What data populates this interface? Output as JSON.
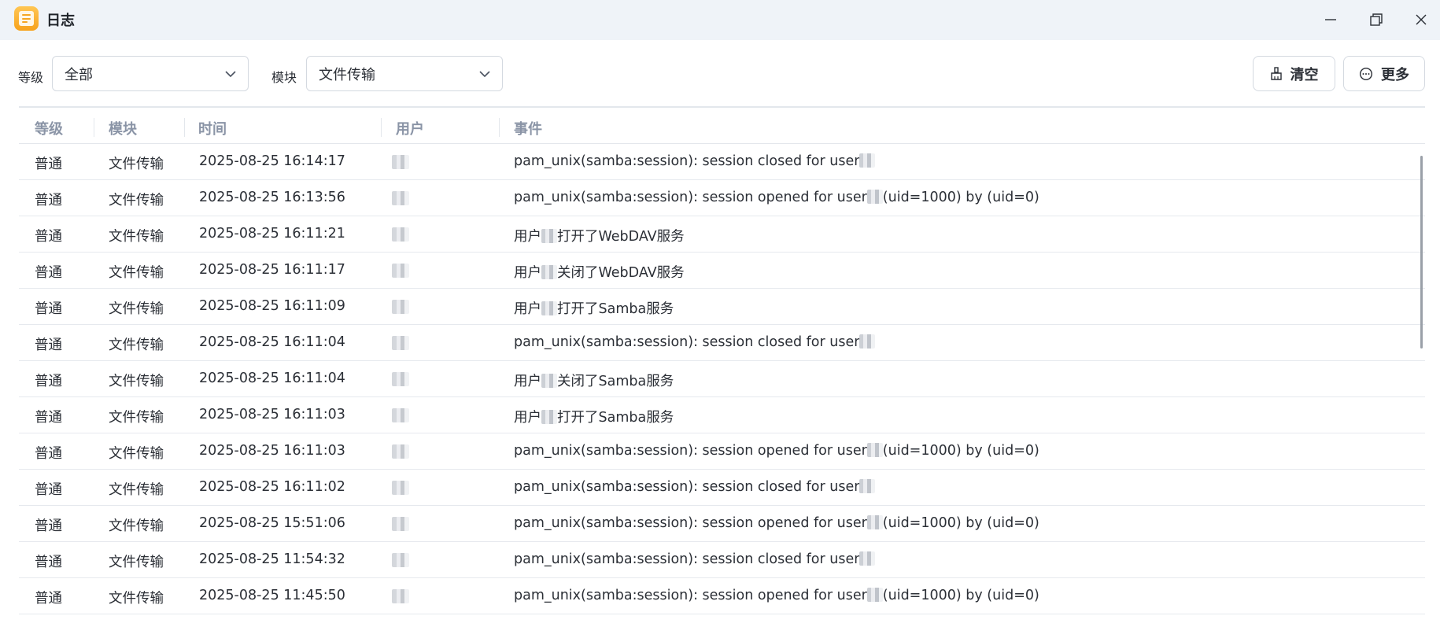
{
  "window": {
    "title": "日志",
    "controls": [
      "minimize-icon",
      "maximize-icon",
      "close-icon"
    ]
  },
  "filters": {
    "level_label": "等级",
    "level_value": "全部",
    "module_label": "模块",
    "module_value": "文件传输"
  },
  "actions": {
    "clear_label": "清空",
    "more_label": "更多"
  },
  "table": {
    "headers": [
      "等级",
      "模块",
      "时间",
      "用户",
      "事件"
    ],
    "rows": [
      {
        "level": "普通",
        "module": "文件传输",
        "time": "2025-08-25 16:14:17",
        "event_pre": "pam_unix(samba:session): session closed for user",
        "event_post": ""
      },
      {
        "level": "普通",
        "module": "文件传输",
        "time": "2025-08-25 16:13:56",
        "event_pre": "pam_unix(samba:session): session opened for user",
        "event_post": "(uid=1000) by (uid=0)"
      },
      {
        "level": "普通",
        "module": "文件传输",
        "time": "2025-08-25 16:11:21",
        "event_pre": "用户",
        "event_post": "打开了WebDAV服务"
      },
      {
        "level": "普通",
        "module": "文件传输",
        "time": "2025-08-25 16:11:17",
        "event_pre": "用户",
        "event_post": "关闭了WebDAV服务"
      },
      {
        "level": "普通",
        "module": "文件传输",
        "time": "2025-08-25 16:11:09",
        "event_pre": "用户",
        "event_post": "打开了Samba服务"
      },
      {
        "level": "普通",
        "module": "文件传输",
        "time": "2025-08-25 16:11:04",
        "event_pre": "pam_unix(samba:session): session closed for user",
        "event_post": ""
      },
      {
        "level": "普通",
        "module": "文件传输",
        "time": "2025-08-25 16:11:04",
        "event_pre": "用户",
        "event_post": "关闭了Samba服务"
      },
      {
        "level": "普通",
        "module": "文件传输",
        "time": "2025-08-25 16:11:03",
        "event_pre": "用户",
        "event_post": "打开了Samba服务"
      },
      {
        "level": "普通",
        "module": "文件传输",
        "time": "2025-08-25 16:11:03",
        "event_pre": "pam_unix(samba:session): session opened for user",
        "event_post": "(uid=1000) by (uid=0)"
      },
      {
        "level": "普通",
        "module": "文件传输",
        "time": "2025-08-25 16:11:02",
        "event_pre": "pam_unix(samba:session): session closed for user",
        "event_post": ""
      },
      {
        "level": "普通",
        "module": "文件传输",
        "time": "2025-08-25 15:51:06",
        "event_pre": "pam_unix(samba:session): session opened for user",
        "event_post": "(uid=1000) by (uid=0)"
      },
      {
        "level": "普通",
        "module": "文件传输",
        "time": "2025-08-25 11:54:32",
        "event_pre": "pam_unix(samba:session): session closed for user",
        "event_post": ""
      },
      {
        "level": "普通",
        "module": "文件传输",
        "time": "2025-08-25 11:45:50",
        "event_pre": "pam_unix(samba:session): session opened for user",
        "event_post": "(uid=1000) by (uid=0)"
      }
    ]
  },
  "colors": {
    "titlebar_bg": "#eff3f8",
    "header_text": "#8a94a6",
    "app_icon": "#f7a21b"
  }
}
